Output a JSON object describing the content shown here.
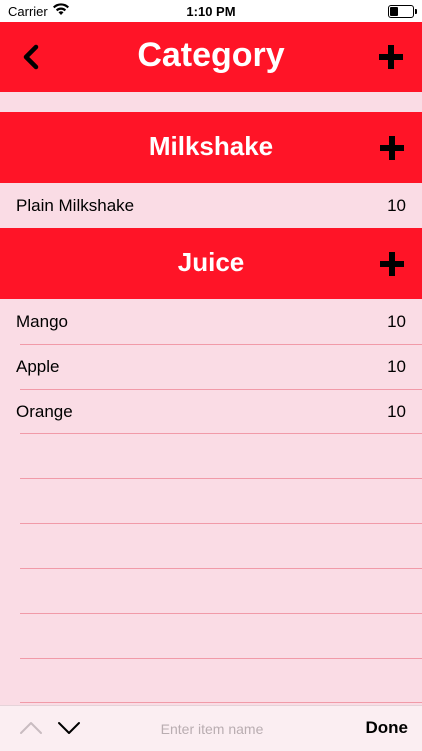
{
  "status_bar": {
    "carrier": "Carrier",
    "time": "1:10 PM",
    "battery_level": 0.35,
    "icons": [
      "wifi-icon",
      "battery-icon"
    ]
  },
  "nav": {
    "title": "Category",
    "back_icon": "chevron-left-icon",
    "add_icon": "plus-icon"
  },
  "sections": [
    {
      "title": "Milkshake",
      "add_icon": "plus-icon",
      "items": [
        {
          "name": "Plain Milkshake",
          "qty": "10"
        }
      ]
    },
    {
      "title": "Juice",
      "add_icon": "plus-icon",
      "items": [
        {
          "name": "Mango",
          "qty": "10"
        },
        {
          "name": "Apple",
          "qty": "10"
        },
        {
          "name": "Orange",
          "qty": "10"
        }
      ]
    }
  ],
  "accessory_bar": {
    "placeholder": "Enter item name",
    "done_label": "Done",
    "prev_icon": "chevron-up-icon",
    "next_icon": "chevron-down-icon"
  },
  "colors": {
    "accent": "#ff1427",
    "background": "#fadce5",
    "separator": "#f19aa8"
  }
}
